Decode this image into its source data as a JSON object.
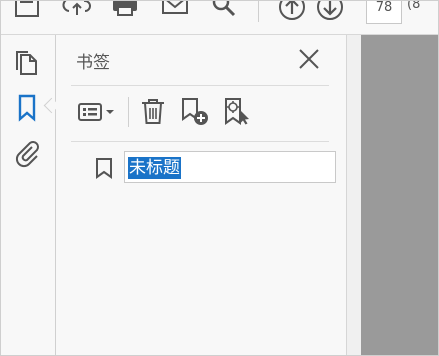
{
  "toolbar": {
    "icons": [
      "save-icon",
      "upload-icon",
      "print-icon",
      "email-icon",
      "search-icon",
      "page-up-icon",
      "page-down-icon"
    ],
    "page_number": "78",
    "page_total_partial": "(8"
  },
  "rail": {
    "items": [
      "pages-icon",
      "bookmark-icon",
      "attachment-icon"
    ],
    "active": "bookmark-icon",
    "active_color": "#1a73c8"
  },
  "panel": {
    "title": "书签",
    "tools": [
      "options-menu-icon",
      "delete-icon",
      "new-bookmark-icon",
      "bookmark-from-selection-icon"
    ],
    "bookmarks": [
      {
        "label": "未标题",
        "editing": true,
        "selected_text": true
      }
    ]
  },
  "colors": {
    "selection": "#1a73c8",
    "document_background": "#9a9a9a",
    "panel_background": "#f8f8f8"
  }
}
